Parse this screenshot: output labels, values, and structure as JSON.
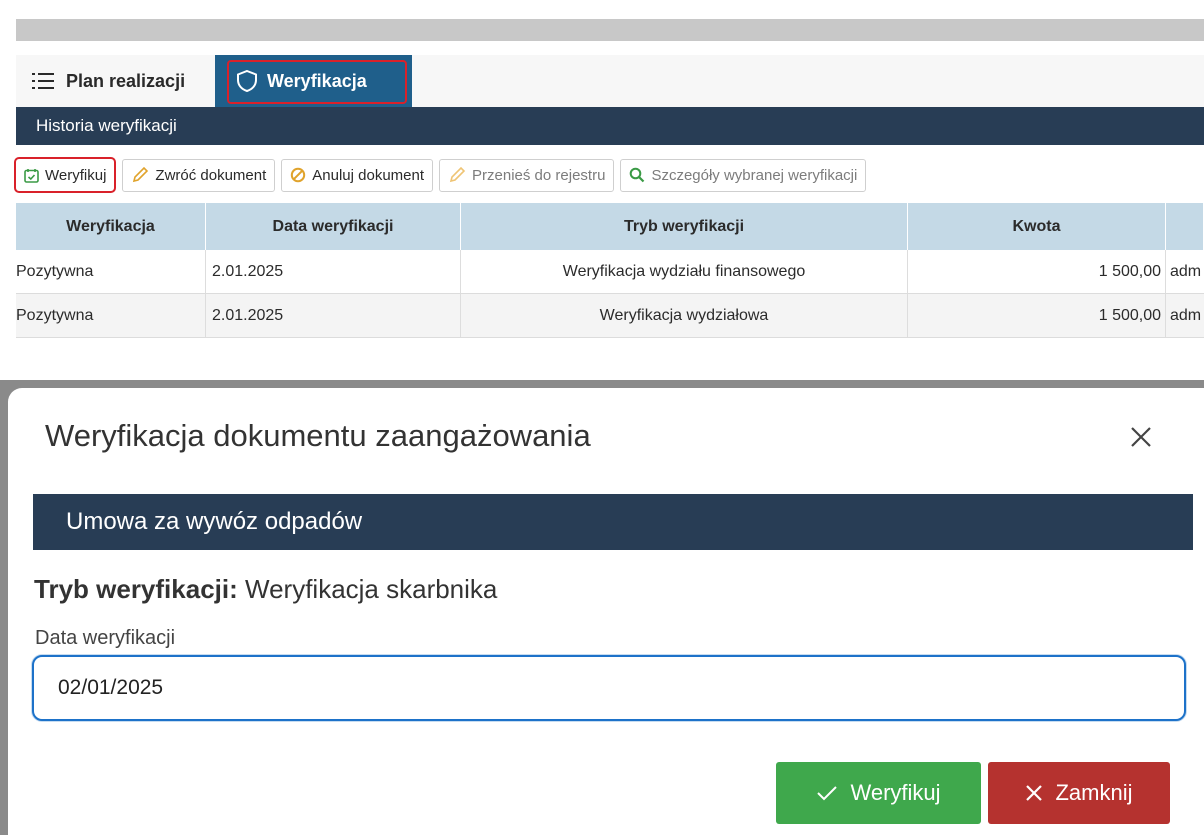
{
  "tabs": [
    {
      "label": "Plan realizacji",
      "icon": "list-icon"
    },
    {
      "label": "Weryfikacja",
      "icon": "shield-icon"
    }
  ],
  "history_title": "Historia weryfikacji",
  "toolbar": {
    "verify": "Weryfikuj",
    "return_doc": "Zwróć dokument",
    "cancel_doc": "Anuluj dokument",
    "move_to_register": "Przenieś do rejestru",
    "details": "Szczegóły wybranej weryfikacji"
  },
  "grid": {
    "headers": [
      "Weryfikacja",
      "Data weryfikacji",
      "Tryb weryfikacji",
      "Kwota",
      ""
    ],
    "rows": [
      [
        "Pozytywna",
        "2.01.2025",
        "Weryfikacja wydziału finansowego",
        "1 500,00",
        "adm"
      ],
      [
        "Pozytywna",
        "2.01.2025",
        "Weryfikacja wydziałowa",
        "1 500,00",
        "adm"
      ]
    ]
  },
  "modal": {
    "title": "Weryfikacja dokumentu zaangażowania",
    "document_name": "Umowa za wywóz odpadów",
    "mode_label": "Tryb weryfikacji:",
    "mode_value": "Weryfikacja skarbnika",
    "date_label": "Data weryfikacji",
    "date_value": "02/01/2025",
    "ok_label": "Weryfikuj",
    "close_label": "Zamknij"
  },
  "colors": {
    "accent_blue": "#1f5f8b",
    "dark_bar": "#283d55",
    "highlight_red": "#d9212a",
    "success_green": "#3fa84c",
    "danger_red": "#b5322f"
  }
}
